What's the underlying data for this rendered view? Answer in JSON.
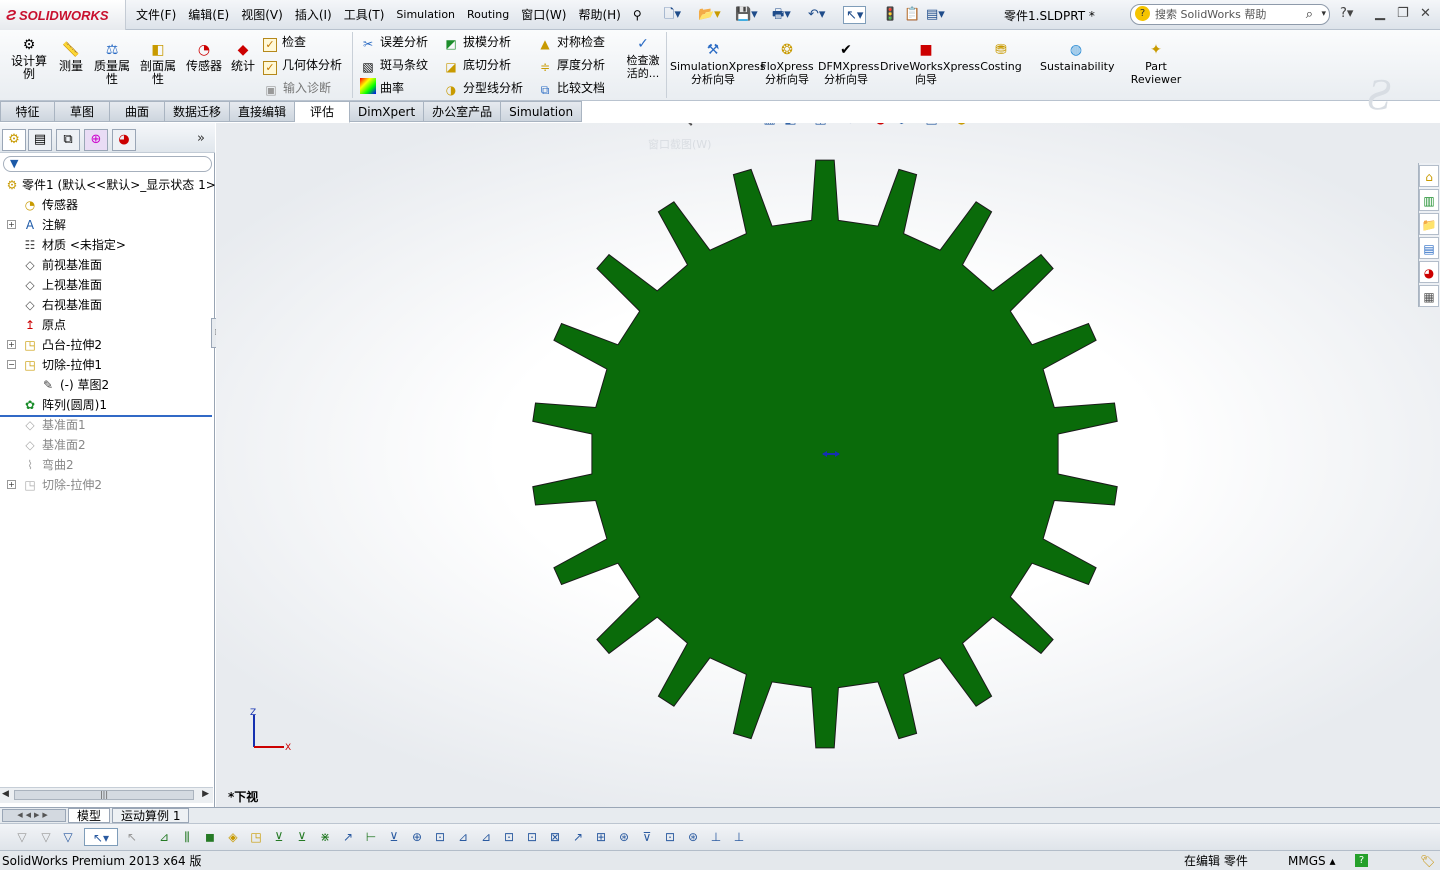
{
  "app": {
    "brand": "SOLIDWORKS",
    "document_title": "零件1.SLDPRT *"
  },
  "menu": [
    "文件(F)",
    "编辑(E)",
    "视图(V)",
    "插入(I)",
    "工具(T)",
    "Simulation",
    "Routing",
    "窗口(W)",
    "帮助(H)"
  ],
  "search": {
    "placeholder": "搜索 SolidWorks 帮助"
  },
  "ribbon": {
    "large": [
      {
        "label": "设计算例",
        "icon": "design-study-icon"
      },
      {
        "label": "测量",
        "icon": "measure-icon"
      },
      {
        "label": "质量属性",
        "icon": "mass-properties-icon"
      },
      {
        "label": "剖面属性",
        "icon": "section-properties-icon"
      },
      {
        "label": "传感器",
        "icon": "sensor-icon"
      },
      {
        "label": "统计",
        "icon": "statistics-icon"
      }
    ],
    "col1": [
      "检查",
      "几何体分析",
      "输入诊断"
    ],
    "col2": [
      "误差分析",
      "斑马条纹",
      "曲率"
    ],
    "col3": [
      "拔模分析",
      "底切分析",
      "分型线分析"
    ],
    "col4": [
      "对称检查",
      "厚度分析",
      "比较文档"
    ],
    "check_active": "检查激活的...",
    "xpress": [
      "SimulationXpress 分析向导",
      "FloXpress 分析向导",
      "DFMXpress 分析向导",
      "DriveWorksXpress 向导",
      "Costing",
      "Sustainability",
      "Part Reviewer"
    ]
  },
  "tabs": [
    "特征",
    "草图",
    "曲面",
    "数据迁移",
    "直接编辑",
    "评估",
    "DimXpert",
    "办公室产品",
    "Simulation"
  ],
  "active_tab": "评估",
  "tree": [
    {
      "label": "零件1 (默认<<默认>_显示状态 1>)",
      "icon": "part-icon",
      "state": "normal"
    },
    {
      "label": "传感器",
      "icon": "sensor-folder-icon",
      "state": "normal"
    },
    {
      "label": "注解",
      "icon": "annotation-icon",
      "state": "normal"
    },
    {
      "label": "材质 <未指定>",
      "icon": "material-icon",
      "state": "normal"
    },
    {
      "label": "前视基准面",
      "icon": "plane-icon",
      "state": "normal"
    },
    {
      "label": "上视基准面",
      "icon": "plane-icon",
      "state": "normal"
    },
    {
      "label": "右视基准面",
      "icon": "plane-icon",
      "state": "normal"
    },
    {
      "label": "原点",
      "icon": "origin-icon",
      "state": "normal"
    },
    {
      "label": "凸台-拉伸2",
      "icon": "extrude-icon",
      "state": "normal"
    },
    {
      "label": "切除-拉伸1",
      "icon": "cut-extrude-icon",
      "state": "normal"
    },
    {
      "label": "(-) 草图2",
      "icon": "sketch-icon",
      "state": "normal"
    },
    {
      "label": "阵列(圆周)1",
      "icon": "circular-pattern-icon",
      "state": "normal"
    },
    {
      "label": "基准面1",
      "icon": "plane-icon",
      "state": "suppressed"
    },
    {
      "label": "基准面2",
      "icon": "plane-icon",
      "state": "suppressed"
    },
    {
      "label": "弯曲2",
      "icon": "flex-icon",
      "state": "suppressed"
    },
    {
      "label": "切除-拉伸2",
      "icon": "cut-extrude-icon",
      "state": "suppressed"
    }
  ],
  "viewport": {
    "tooltip": "窗口截图(W)",
    "view_label": "*下视",
    "gear_color": "#0a6b0a",
    "teeth": 22,
    "triad": {
      "z": "Z",
      "x": "X"
    }
  },
  "bottom_tabs": [
    "模型",
    "运动算例 1"
  ],
  "status": {
    "product": "SolidWorks Premium 2013 x64 版",
    "mode": "在编辑 零件",
    "units": "MMGS",
    "help": "?"
  }
}
